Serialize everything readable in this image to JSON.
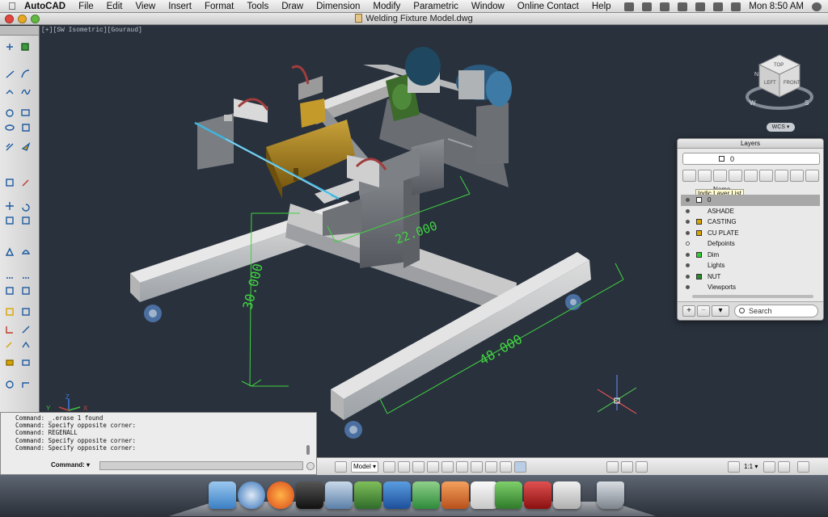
{
  "menubar": {
    "app_name": "AutoCAD",
    "menus": [
      "File",
      "Edit",
      "View",
      "Insert",
      "Format",
      "Tools",
      "Draw",
      "Dimension",
      "Modify",
      "Parametric",
      "Window",
      "Online Contact",
      "Help"
    ],
    "clock": "Mon 8:50 AM",
    "status_icons": [
      "x-icon",
      "evernote-icon",
      "sync-icon",
      "time-machine-icon",
      "wifi-icon",
      "volume-icon",
      "battery-icon",
      "bluetooth-icon",
      "spotlight-icon"
    ]
  },
  "window": {
    "title": "Welding Fixture Model.dwg"
  },
  "viewport": {
    "view_label": "[+][SW Isometric][Gouraud]",
    "dimensions": [
      "30.000",
      "22.000",
      "48.000"
    ],
    "viewcube": {
      "top_label": "TOP",
      "left_label": "LEFT",
      "front_label": "FRONT",
      "compass": [
        "N",
        "W",
        "S"
      ],
      "ucs_menu": "WCS"
    },
    "ucs_axis_labels": [
      "Z",
      "Y",
      "X"
    ]
  },
  "layers_palette": {
    "title": "Layers",
    "current_layer": "0",
    "column_name": "Name",
    "tooltip": "Indic Layer List",
    "rows": [
      {
        "name": "0",
        "color": "#ffffff",
        "on": true,
        "selected": true
      },
      {
        "name": "ASHADE",
        "color": "#ffffff",
        "on": true,
        "selected": false
      },
      {
        "name": "CASTING",
        "color": "#d9a400",
        "on": true,
        "selected": false
      },
      {
        "name": "CU PLATE",
        "color": "#d9a400",
        "on": true,
        "selected": false
      },
      {
        "name": "Defpoints",
        "color": "#ffffff",
        "on": false,
        "selected": false
      },
      {
        "name": "Dim",
        "color": "#2ecc2e",
        "on": true,
        "selected": false
      },
      {
        "name": "Lights",
        "color": "#ffffff",
        "on": true,
        "selected": false
      },
      {
        "name": "NUT",
        "color": "#2a8a2a",
        "on": true,
        "selected": false
      },
      {
        "name": "Viewports",
        "color": "#ffffff",
        "on": true,
        "selected": false
      }
    ],
    "add_label": "+",
    "remove_label": "−",
    "search_placeholder": "Search"
  },
  "command_window": {
    "lines": [
      "Command: _.erase 1 found",
      "Command: Specify opposite corner:",
      "Command: REGENALL",
      "Command: Specify opposite corner:",
      "Command: Specify opposite corner:"
    ],
    "prompt": "Command:"
  },
  "statusbar": {
    "model_tab": "Model",
    "annotation_scale": "1:1"
  },
  "dock": {
    "apps": [
      "finder",
      "safari",
      "firefox",
      "clapperboard",
      "mail",
      "preview",
      "word",
      "network",
      "photo",
      "textedit",
      "evernote",
      "autocad",
      "acrobat",
      "beta",
      "trash"
    ]
  }
}
